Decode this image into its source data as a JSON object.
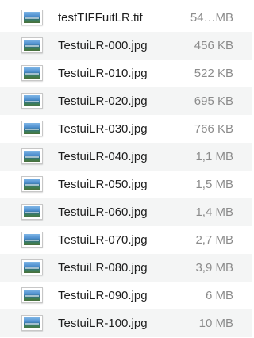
{
  "files": [
    {
      "name": "testTIFFuitLR.tif",
      "size": "54…MB",
      "icon": "image-thumbnail-icon"
    },
    {
      "name": "TestuiLR-000.jpg",
      "size": "456 KB",
      "icon": "image-thumbnail-icon"
    },
    {
      "name": "TestuiLR-010.jpg",
      "size": "522 KB",
      "icon": "image-thumbnail-icon"
    },
    {
      "name": "TestuiLR-020.jpg",
      "size": "695 KB",
      "icon": "image-thumbnail-icon"
    },
    {
      "name": "TestuiLR-030.jpg",
      "size": "766 KB",
      "icon": "image-thumbnail-icon"
    },
    {
      "name": "TestuiLR-040.jpg",
      "size": "1,1 MB",
      "icon": "image-thumbnail-icon"
    },
    {
      "name": "TestuiLR-050.jpg",
      "size": "1,5 MB",
      "icon": "image-thumbnail-icon"
    },
    {
      "name": "TestuiLR-060.jpg",
      "size": "1,4 MB",
      "icon": "image-thumbnail-icon"
    },
    {
      "name": "TestuiLR-070.jpg",
      "size": "2,7 MB",
      "icon": "image-thumbnail-icon"
    },
    {
      "name": "TestuiLR-080.jpg",
      "size": "3,9 MB",
      "icon": "image-thumbnail-icon"
    },
    {
      "name": "TestuiLR-090.jpg",
      "size": "6 MB",
      "icon": "image-thumbnail-icon"
    },
    {
      "name": "TestuiLR-100.jpg",
      "size": "10 MB",
      "icon": "image-thumbnail-icon"
    }
  ],
  "colors": {
    "alt_row": "#f4f5f5",
    "name_text": "#1d1d1d",
    "size_text": "#8c8c8c"
  }
}
